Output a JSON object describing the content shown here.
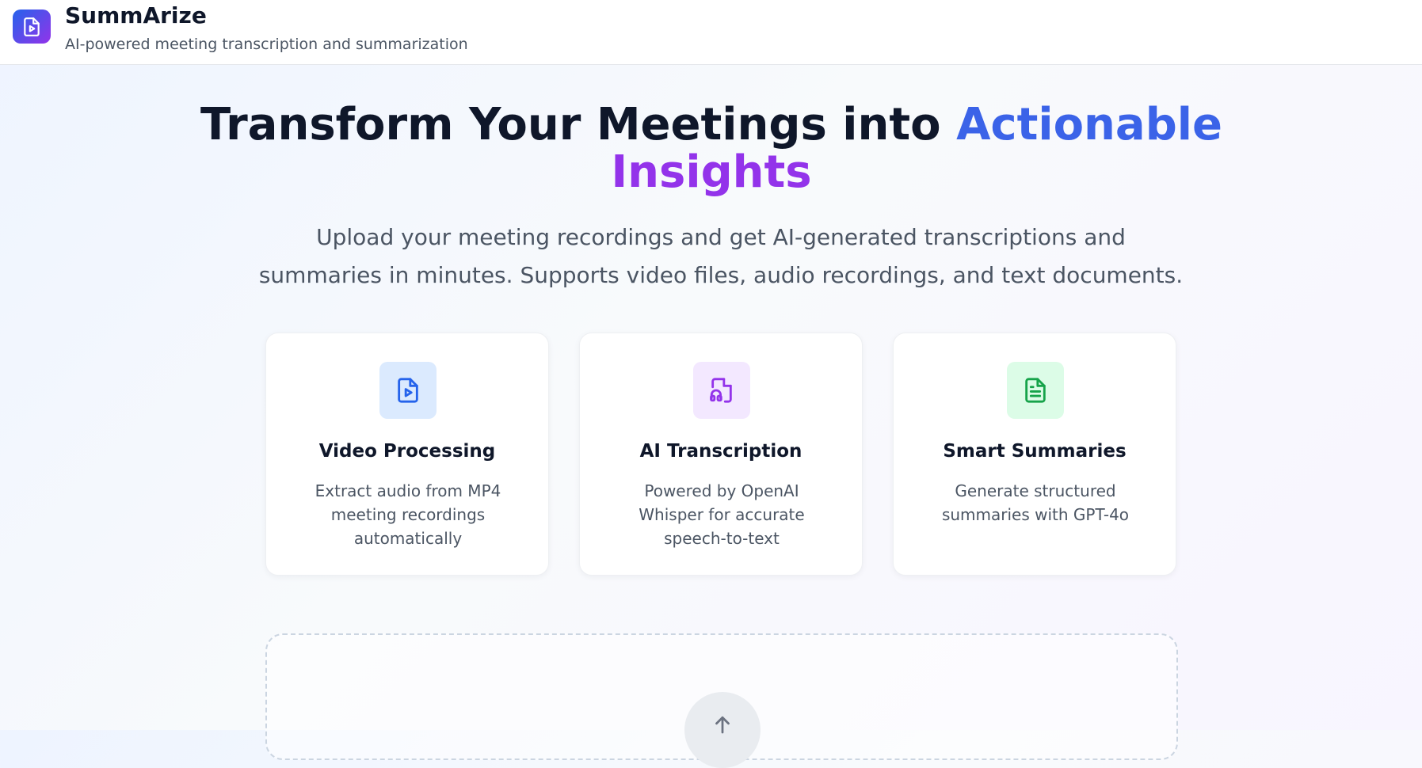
{
  "header": {
    "title": "SummArize",
    "subtitle": "AI-powered meeting transcription and summarization",
    "logo_icon": "file-video-icon"
  },
  "hero": {
    "title_main": "Transform Your Meetings into ",
    "title_accent1": "Actionable",
    "title_accent2": "Insights",
    "description": "Upload your meeting recordings and get AI-generated transcriptions and summaries in minutes. Supports video files, audio recordings, and text documents."
  },
  "features": [
    {
      "title": "Video Processing",
      "description": "Extract audio from MP4 meeting recordings automatically",
      "icon": "file-video-icon",
      "icon_bg": "#dbeafe",
      "icon_color": "#2563eb"
    },
    {
      "title": "AI Transcription",
      "description": "Powered by OpenAI Whisper for accurate speech-to-text",
      "icon": "file-audio-icon",
      "icon_bg": "#f3e8ff",
      "icon_color": "#9333ea"
    },
    {
      "title": "Smart Summaries",
      "description": "Generate structured summaries with GPT-4o",
      "icon": "file-text-icon",
      "icon_bg": "#dcfce7",
      "icon_color": "#16a34a"
    }
  ],
  "upload": {
    "icon": "arrow-up-icon"
  },
  "colors": {
    "brand_blue": "#3b63e8",
    "brand_purple": "#9333ea"
  }
}
